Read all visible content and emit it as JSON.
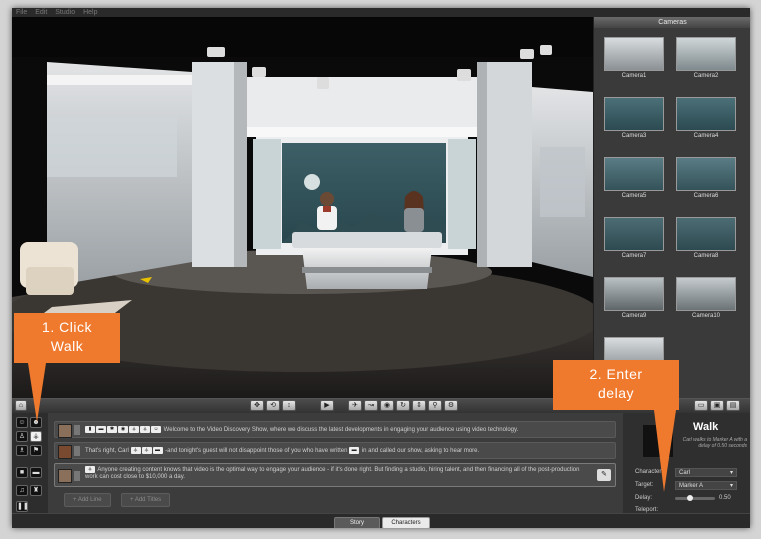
{
  "menubar": {
    "items": [
      "File",
      "Edit",
      "Studio",
      "Help"
    ]
  },
  "cameras": {
    "title": "Cameras",
    "items": [
      {
        "label": "Camera1"
      },
      {
        "label": "Camera2"
      },
      {
        "label": "Camera3"
      },
      {
        "label": "Camera4"
      },
      {
        "label": "Camera5"
      },
      {
        "label": "Camera6"
      },
      {
        "label": "Camera7"
      },
      {
        "label": "Camera8"
      },
      {
        "label": "Camera9"
      },
      {
        "label": "Camera10"
      },
      {
        "label": ""
      }
    ]
  },
  "story": {
    "lines": [
      {
        "text": "Welcome to the Video Discovery Show, where we discuss the latest developments in engaging your audience using video technology."
      },
      {
        "text_a": "That's right, Carl",
        "text_b": "-and tonight's guest will not disappoint those of you who have written",
        "text_c": "in and called our show, asking to hear more."
      },
      {
        "text": "Anyone creating content knows that video is the optimal way to engage your audience - if it's done right. But finding a studio, hiring talent, and then financing all of the post-production work can cost close to $10,000 a day."
      }
    ],
    "add_line": "+ Add Line",
    "add_titles": "+ Add Titles"
  },
  "properties": {
    "title": "Walk",
    "subtitle": "Carl walks to Marker A with a delay of 0.50 seconds",
    "character_label": "Character:",
    "character_value": "Carl",
    "target_label": "Target:",
    "target_value": "Marker A",
    "delay_label": "Delay:",
    "delay_value": "0.50",
    "teleport_label": "Teleport:"
  },
  "tabs": {
    "story": "Story",
    "characters": "Characters"
  },
  "callouts": {
    "one_a": "1. Click",
    "one_b": "Walk",
    "two_a": "2. Enter",
    "two_b": "delay"
  },
  "colors": {
    "callout": "#ef7a2e",
    "backdrop": "#3d5f66"
  }
}
